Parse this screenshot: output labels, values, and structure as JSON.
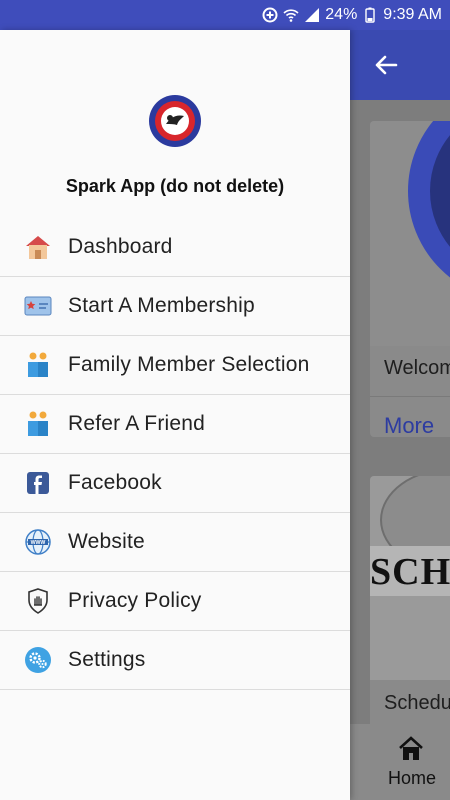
{
  "status_bar": {
    "battery": "24%",
    "time": "9:39 AM"
  },
  "drawer": {
    "app_name": "Spark App (do not delete)",
    "logo_icon": "academy-logo",
    "items": [
      {
        "label": "Dashboard",
        "icon": "house-icon"
      },
      {
        "label": "Start A Membership",
        "icon": "membership-card-icon"
      },
      {
        "label": "Family Member Selection",
        "icon": "people-icon"
      },
      {
        "label": "Refer A Friend",
        "icon": "people-icon"
      },
      {
        "label": "Facebook",
        "icon": "facebook-icon"
      },
      {
        "label": "Website",
        "icon": "globe-www-icon"
      },
      {
        "label": "Privacy Policy",
        "icon": "shield-hand-icon"
      },
      {
        "label": "Settings",
        "icon": "gears-icon"
      }
    ]
  },
  "background_app": {
    "welcome_text": "Welcom",
    "more_link": "More",
    "schedule_image_text": "SCHE",
    "schedule_caption": "Schedu",
    "bottom_nav": {
      "home_label": "Home"
    }
  },
  "colors": {
    "status_bar": "#3f4dbb",
    "app_bar": "#3a4ab1",
    "link": "#3a4ab1",
    "drawer_bg": "#fafafa"
  }
}
